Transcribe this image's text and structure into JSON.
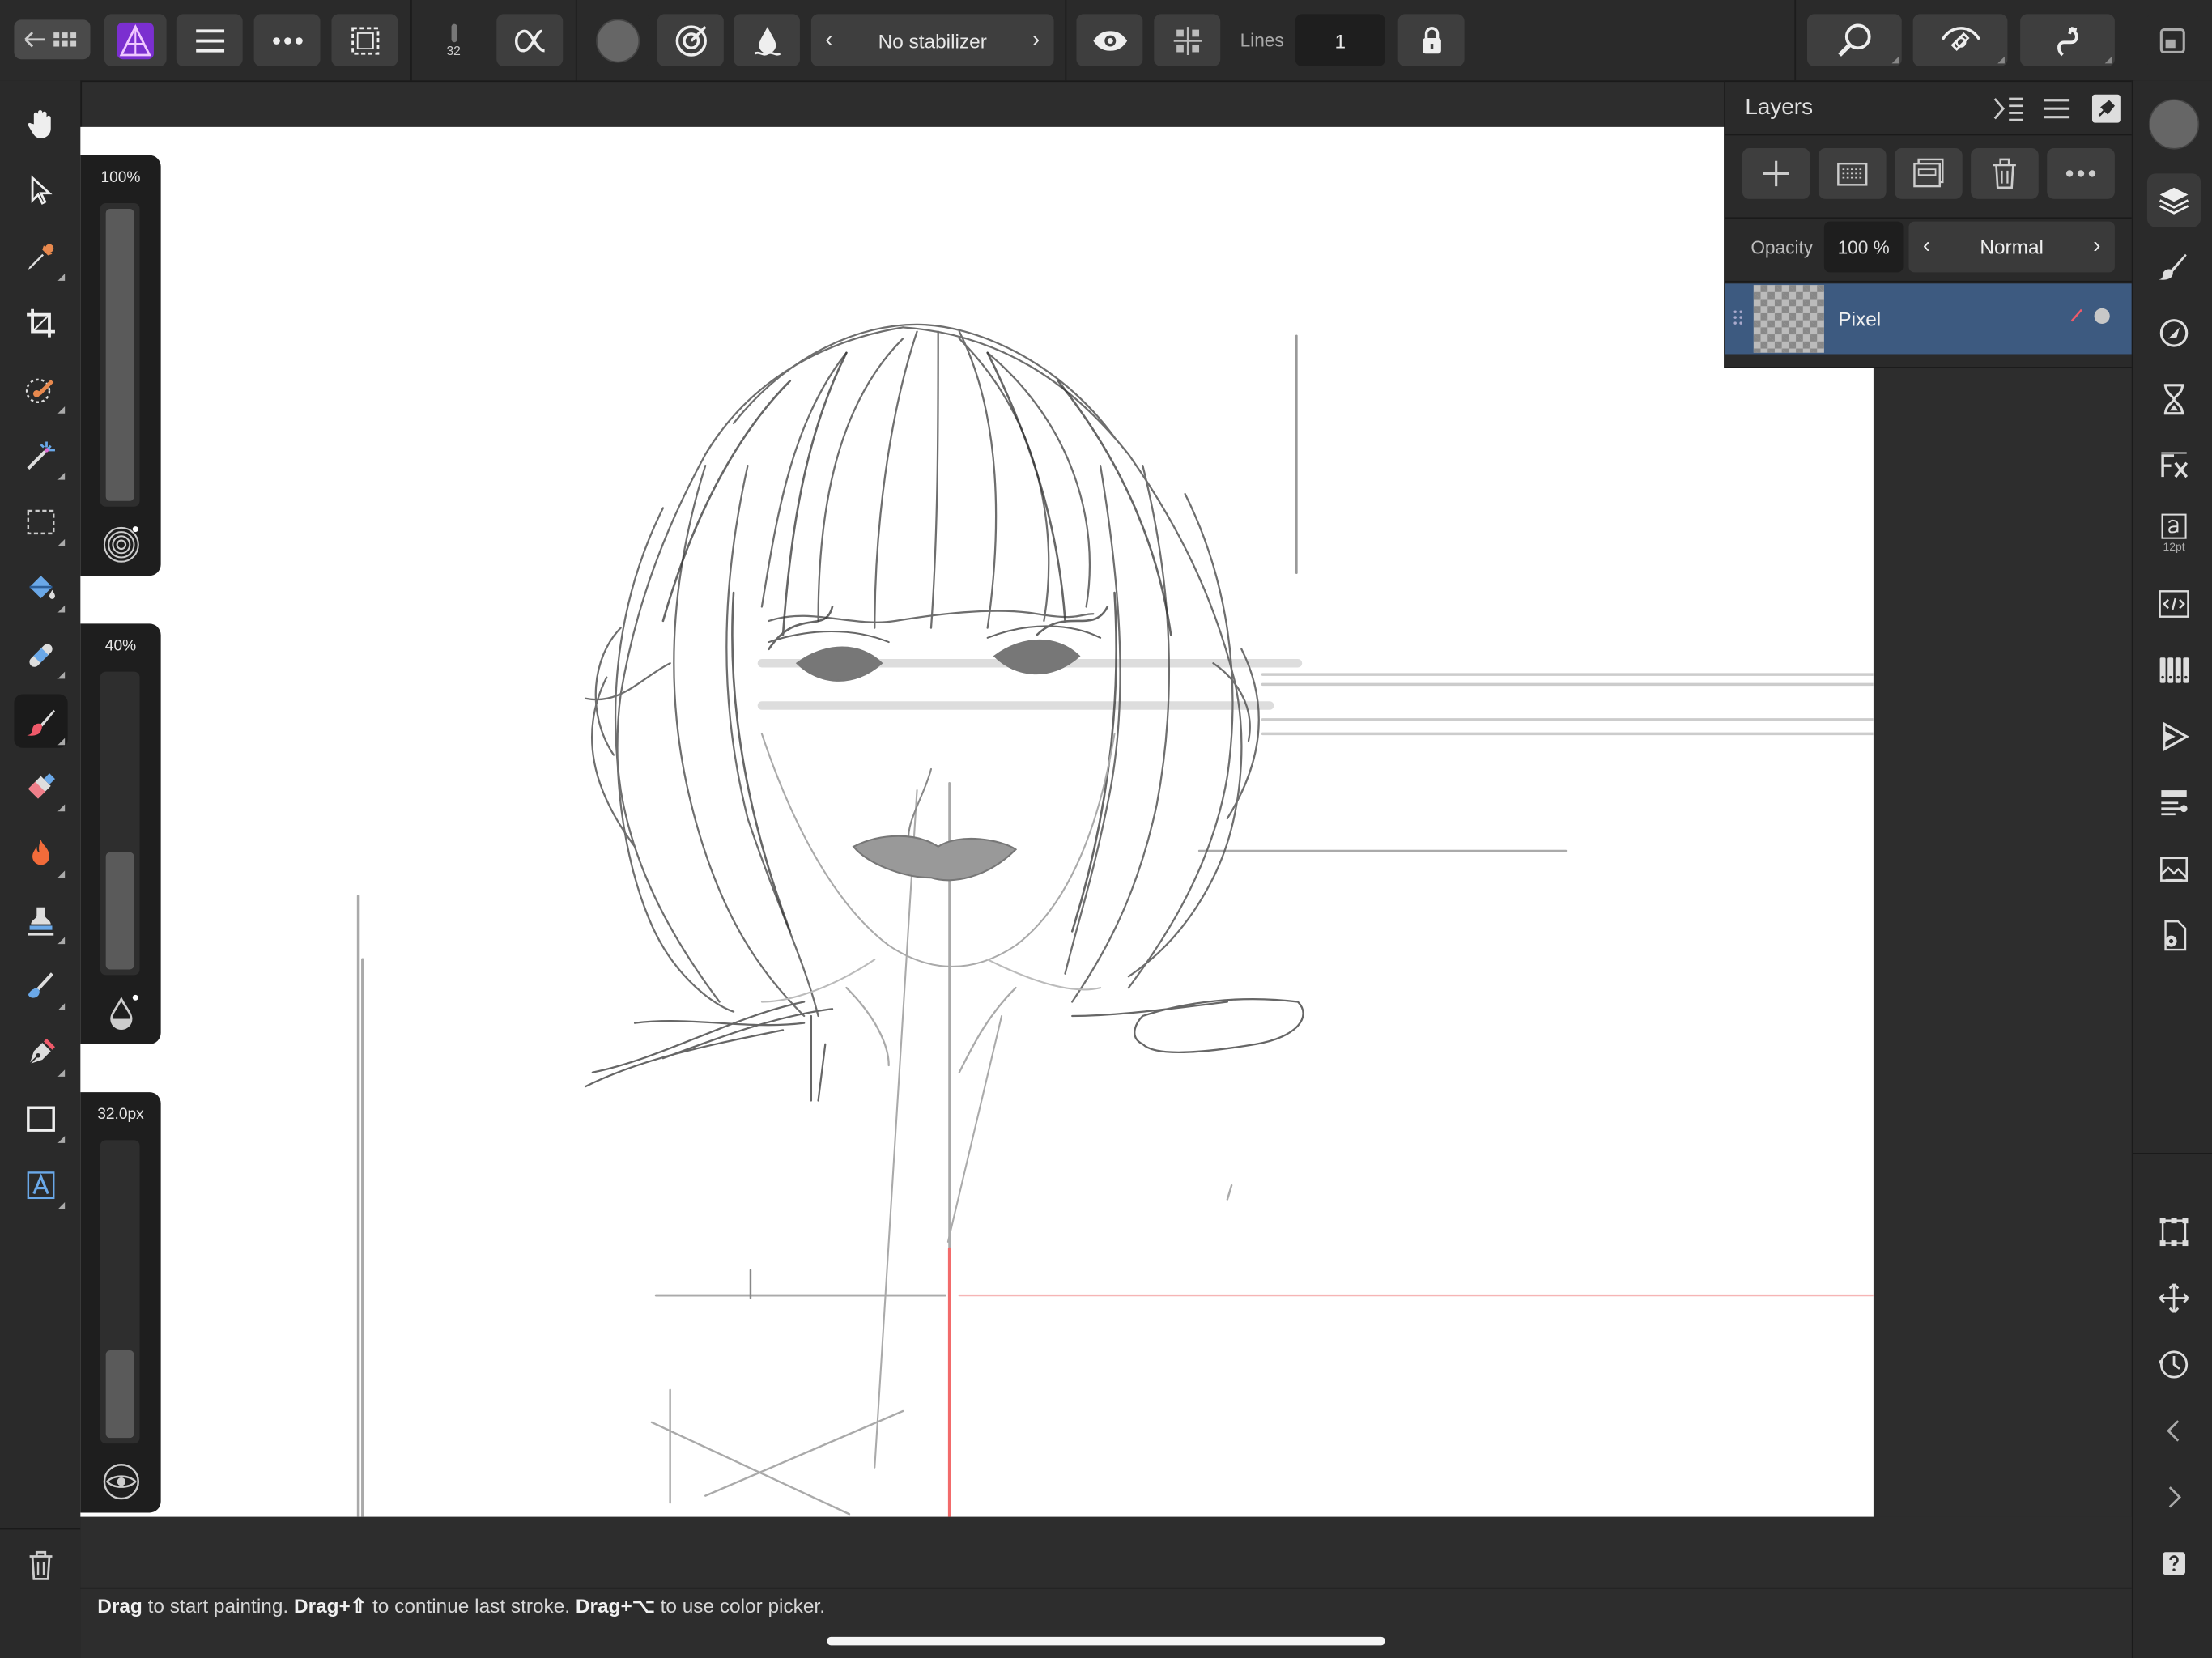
{
  "toolbar": {
    "brush_size_badge": "32",
    "stabilizer_label": "No stabilizer",
    "lines_label": "Lines",
    "lines_value": "1"
  },
  "sliders": {
    "opacity_label": "100%",
    "opacity_level": 1.0,
    "flow_label": "40%",
    "flow_level": 0.4,
    "width_label": "32.0px",
    "width_level": 0.3
  },
  "layers_panel": {
    "title": "Layers",
    "opacity_label": "Opacity",
    "opacity_value": "100 %",
    "blend_mode": "Normal",
    "layer_name": "Pixel"
  },
  "right_panel": {
    "text_studio_size": "12pt"
  },
  "status": {
    "drag1": "Drag",
    "text1": " to start painting. ",
    "drag2": "Drag+⇧",
    "text2": " to continue last stroke. ",
    "drag3": "Drag+⌥",
    "text3": " to use color picker."
  },
  "colors": {
    "accent_layer": "#3d5a80",
    "app_icon": "#a44cf0",
    "guide_red": "#f26b6b"
  }
}
